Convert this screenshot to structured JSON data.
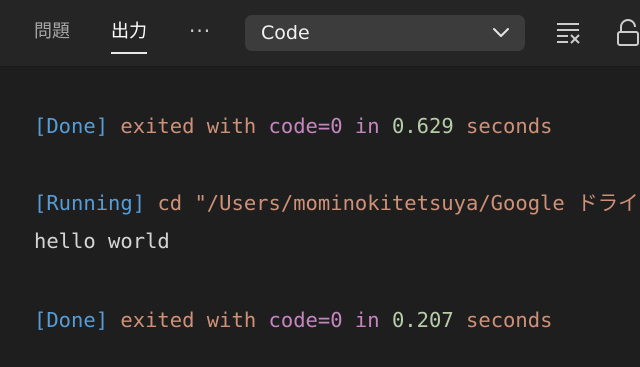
{
  "tabs": [
    {
      "label": "問題",
      "active": false
    },
    {
      "label": "出力",
      "active": true
    }
  ],
  "more_label": "···",
  "channel_select": {
    "value": "Code"
  },
  "icons": [
    "more-icon",
    "chevron-down-icon",
    "clear-output-icon",
    "lock-icon"
  ],
  "colors": {
    "background": "#1e1e1e",
    "header": "#252526",
    "bracket": "#569cd6",
    "text": "#ce9178",
    "keyword": "#c586c0",
    "number": "#b5cea8",
    "plain": "#d4d4d4"
  },
  "output": {
    "line1": {
      "tag": "[Done]",
      "t1": "exited with",
      "code": "code=0",
      "in": "in",
      "time": "0.629",
      "unit": "seconds"
    },
    "line2": {
      "tag": "[Running]",
      "command": "cd \"/Users/mominokitetsuya/Google ドライ"
    },
    "line3": {
      "text": "hello world"
    },
    "line4": {
      "tag": "[Done]",
      "t1": "exited with",
      "code": "code=0",
      "in": "in",
      "time": "0.207",
      "unit": "seconds"
    }
  }
}
